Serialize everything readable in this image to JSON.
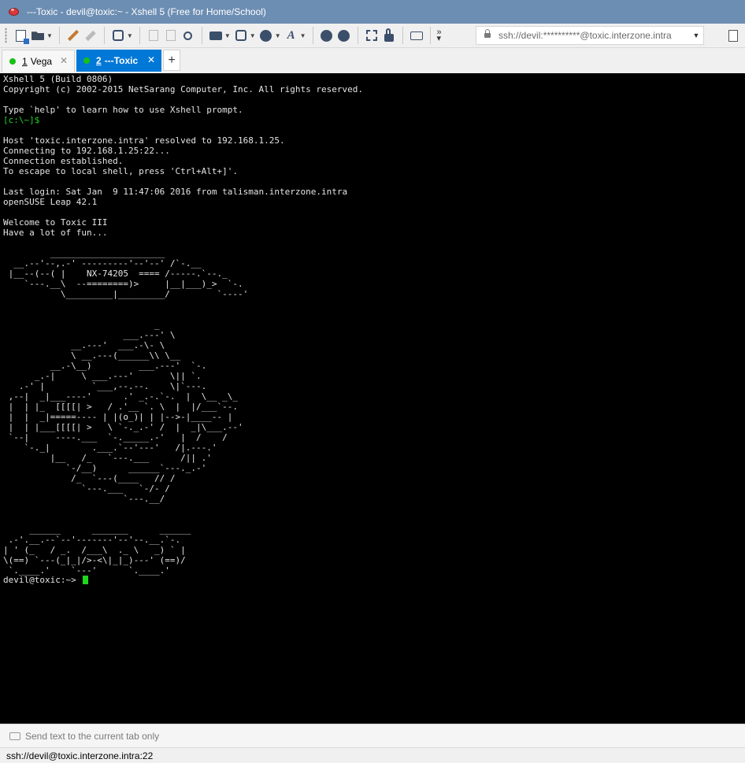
{
  "window": {
    "title": "---Toxic - devil@toxic:~ - Xshell 5 (Free for Home/School)"
  },
  "toolbar": {
    "icons": [
      "new-session-icon",
      "open-folder-icon",
      "reconnect-icon",
      "disconnect-icon",
      "properties-icon",
      "copy-icon",
      "paste-icon",
      "find-icon",
      "print-icon",
      "transfer-icon",
      "globe-icon",
      "font-icon",
      "xftp-icon",
      "xagent-icon",
      "fullscreen-icon",
      "lock-icon",
      "keyboard-icon",
      "more-icon"
    ],
    "address": "ssh://devil:**********@toxic.interzone.intra"
  },
  "tabs": [
    {
      "number": "1",
      "label": "Vega",
      "active": false
    },
    {
      "number": "2",
      "label": "---Toxic",
      "active": true
    }
  ],
  "terminal": {
    "lines": [
      "Xshell 5 (Build 0806)",
      "Copyright (c) 2002-2015 NetSarang Computer, Inc. All rights reserved.",
      "",
      "Type `help' to learn how to use Xshell prompt.",
      "[c:\\~]$",
      "",
      "Host 'toxic.interzone.intra' resolved to 192.168.1.25.",
      "Connecting to 192.168.1.25:22...",
      "Connection established.",
      "To escape to local shell, press 'Ctrl+Alt+]'.",
      "",
      "Last login: Sat Jan  9 11:47:06 2016 from talisman.interzone.intra",
      "openSUSE Leap 42.1",
      "",
      "Welcome to Toxic III",
      "Have a lot of fun...",
      "",
      "         ______________________",
      "  __.--'--,.-' ---------'--'--' /`-.__",
      " |__--(--( |    NX-74205  ==== /-----.`--._",
      "    `---.__\\  --========)>     |__|___)_>  `-.",
      "           \\_________|_________/         `----'",
      "",
      "",
      "                             _",
      "                       ___.---' \\",
      "             __.---'  ___.-\\- \\",
      "             \\ __.---(______\\\\ \\__",
      "         __.-\\__)         ___.---'  `-.",
      "      _.-|     \\ ___.---'       \\|| `.",
      "   .-' |         `___,--.--.    \\|`---.",
      " ,--|  _|___----'      .' _.-.`-.  |  \\__ _\\_",
      " |  | |_  [[[[| >   / .'__ `. \\  |  |/___`--.",
      " |  |  _|=====---- | |(o_)| | |-->-|____-- |",
      " |  | |___[[[[| >   \\ `-._.-' /  |  _|\\___.--'",
      " `--|     ----.___  `-._____.-'   |  /    /",
      "    `-._|        .___.`--'---'   /|.---.'",
      "         |__   /_   `---.___      /|| .'",
      "            `-/__)      ______`---._.-'",
      "             /_  `---(____   // /",
      "               `---.___   `-/- /",
      "                       `---.__/",
      "",
      "",
      "     ______      _______      ______",
      " .-'.__.--`--'-------'--'--.__.`-.",
      "| ' (_   / _.  /___\\  ._ \\   _) ` |",
      "\\(==) `---(_|_|/>-<\\|_|_)---' (==)/",
      " `.____.'    `---'      `.____.'"
    ],
    "prompt": "devil@toxic:~>"
  },
  "sendbar": {
    "placeholder": "Send text to the current tab only"
  },
  "status": {
    "connection": "ssh://devil@toxic.interzone.intra:22"
  },
  "colors": {
    "titlebar": "#6d8eb3",
    "active_tab": "#0078d7",
    "terminal_bg": "#000000",
    "terminal_fg": "#e5e5e5",
    "cursor": "#1ed61e",
    "tab_status_dot": "#15c215"
  }
}
